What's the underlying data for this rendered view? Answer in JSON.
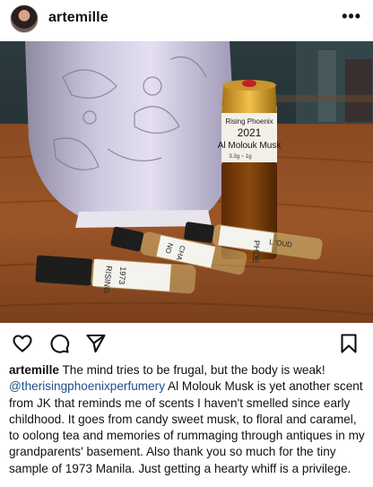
{
  "post": {
    "username": "artemille",
    "more_label": "•••",
    "avatar_icon": "profile-avatar",
    "photo": {
      "label_line1": "Rising Phoenix",
      "label_year": "2021",
      "label_name": "Al Molouk Musk",
      "label_small": "3.3g ~ 1g",
      "vial1": "PHOE",
      "vial1b": "L 'OUD",
      "vial2a": "NO",
      "vial2b": "CHA",
      "vial3a": "RISING",
      "vial3b": "1973"
    },
    "actions": {
      "like_icon": "heart-icon",
      "comment_icon": "comment-icon",
      "share_icon": "send-icon",
      "save_icon": "bookmark-icon"
    },
    "caption": {
      "author": "artemille",
      "lead": " The mind tries to be frugal, but the body is weak!",
      "mention": "@therisingphoenixperfumery",
      "body": " Al Molouk Musk is yet another scent from JK that reminds me of scents I haven't smelled since early childhood. It goes from candy sweet musk, to floral and caramel, to oolong tea and memories of rummaging through antiques in my grandparents' basement. Also thank you so much for the tiny sample of 1973 Manila. Just getting a hearty whiff is a privilege."
    }
  }
}
